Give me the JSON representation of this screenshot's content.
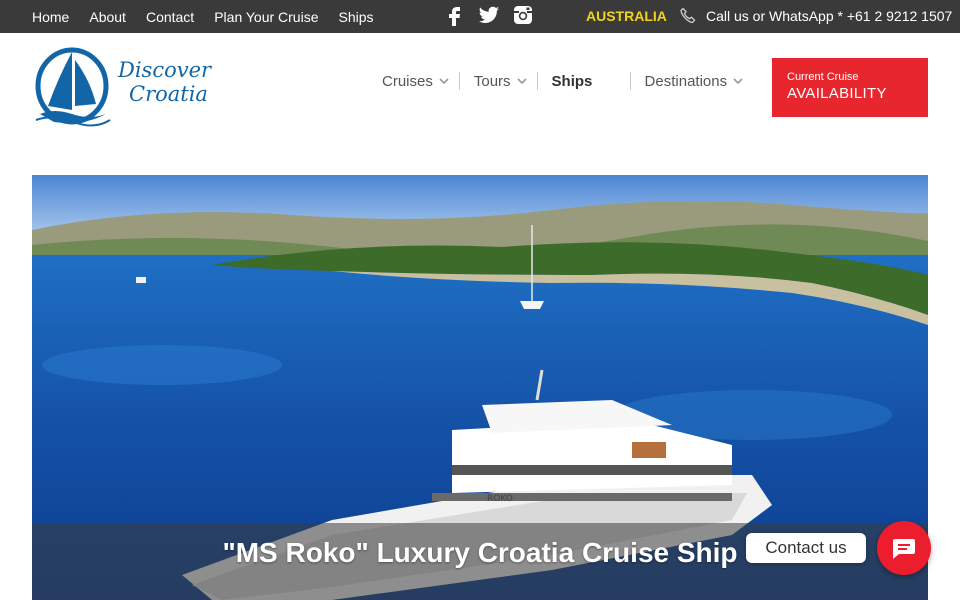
{
  "topbar": {
    "links": [
      "Home",
      "About",
      "Contact",
      "Plan Your Cruise",
      "Ships"
    ],
    "social_icons": [
      "facebook-icon",
      "twitter-icon",
      "instagram-icon"
    ],
    "region": "AUSTRALIA",
    "phone_text": "Call us or WhatsApp * +61 2 9212 1507"
  },
  "logo": {
    "line1": "Discover",
    "line2": "Croatia"
  },
  "nav": {
    "items": [
      {
        "label": "Cruises",
        "dropdown": true
      },
      {
        "label": "Tours",
        "dropdown": true
      },
      {
        "label": "Ships",
        "dropdown": false,
        "active": true
      },
      {
        "label": "Destinations",
        "dropdown": true
      }
    ]
  },
  "availability": {
    "sub": "Current Cruise",
    "main": "AVAILABILITY"
  },
  "hero": {
    "caption": "\"MS Roko\" Luxury Croatia Cruise Ship",
    "boat_name": "ROKO"
  },
  "contact": {
    "label": "Contact us"
  },
  "colors": {
    "topbar_bg": "#3a3a3a",
    "region": "#f2d21b",
    "brand_blue": "#1266a8",
    "accent_red": "#e8262d",
    "sea": "#1451a6"
  }
}
